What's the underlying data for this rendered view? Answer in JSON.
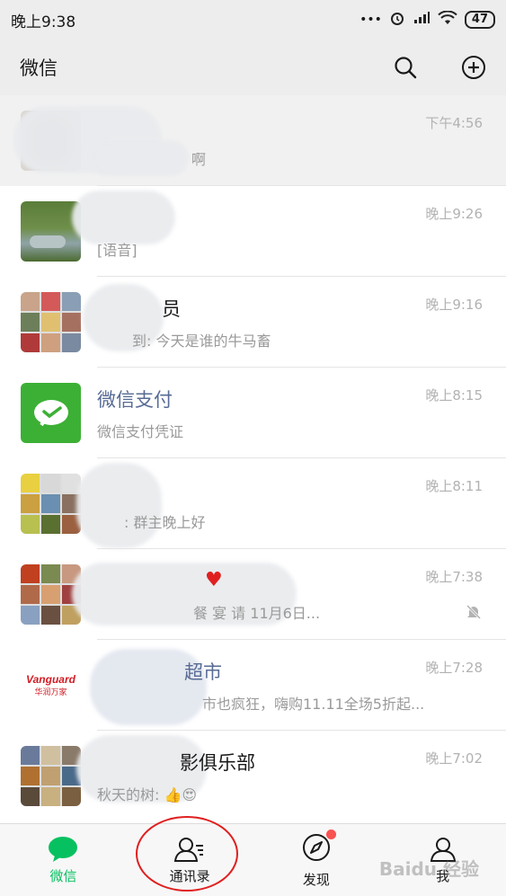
{
  "status_bar": {
    "time": "晚上9:38",
    "dots": "•••",
    "battery": "47"
  },
  "header": {
    "title": "微信"
  },
  "chats": [
    {
      "name": "",
      "preview": "啊",
      "time": "下午4:56"
    },
    {
      "name": "",
      "preview": "[语音]",
      "time": "晚上9:26"
    },
    {
      "name": "员",
      "preview": "到: 今天是谁的牛马畜",
      "time": "晚上9:16"
    },
    {
      "name": "微信支付",
      "preview": "微信支付凭证",
      "time": "晚上8:15"
    },
    {
      "name": "",
      "preview": ": 群主晚上好",
      "time": "晚上8:11"
    },
    {
      "name": "",
      "preview": "餐 宴 请 11月6日...",
      "time": "晚上7:38"
    },
    {
      "name": "超市",
      "preview": "市也疯狂，嗨购11.11全场5折起...",
      "time": "晚上7:28"
    },
    {
      "name": "影俱乐部",
      "preview": "秋天的树: 👍😍",
      "time": "晚上7:02"
    }
  ],
  "vanguard": {
    "brand": "Vanguard",
    "sub": "华润万家"
  },
  "tabbar": {
    "tabs": [
      "微信",
      "通讯录",
      "发现",
      "我"
    ]
  },
  "watermark": "Baidu 经验",
  "colors": {
    "wechat_green": "#07c160",
    "official_blue": "#576b95",
    "highlight_red": "#e02020"
  }
}
